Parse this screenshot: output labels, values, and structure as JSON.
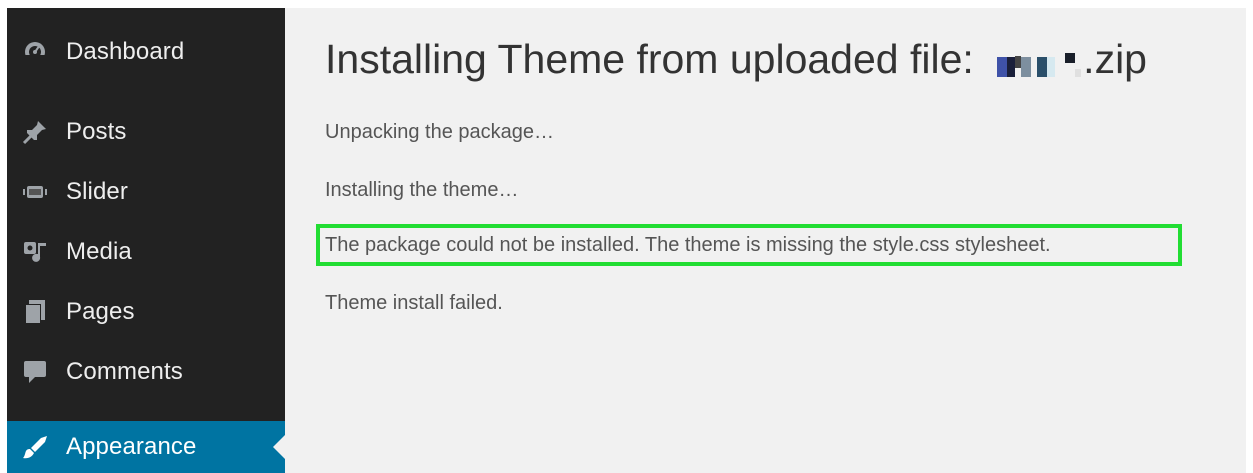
{
  "sidebar": {
    "items": [
      {
        "label": "Dashboard",
        "icon": "dashboard-icon",
        "active": false
      },
      {
        "label": "Posts",
        "icon": "pin-icon",
        "active": false
      },
      {
        "label": "Slider",
        "icon": "slider-icon",
        "active": false
      },
      {
        "label": "Media",
        "icon": "media-icon",
        "active": false
      },
      {
        "label": "Pages",
        "icon": "pages-icon",
        "active": false
      },
      {
        "label": "Comments",
        "icon": "comment-icon",
        "active": false
      },
      {
        "label": "Appearance",
        "icon": "brush-icon",
        "active": true
      }
    ],
    "colors": {
      "background": "#222222",
      "active": "#0074a2"
    }
  },
  "main": {
    "title_prefix": "Installing Theme from uploaded file: ",
    "title_suffix": ".zip",
    "messages": [
      "Unpacking the package…",
      "Installing the theme…",
      "The package could not be installed. The theme is missing the style.css stylesheet.",
      "Theme install failed."
    ],
    "highlight_color": "#22dd33"
  }
}
